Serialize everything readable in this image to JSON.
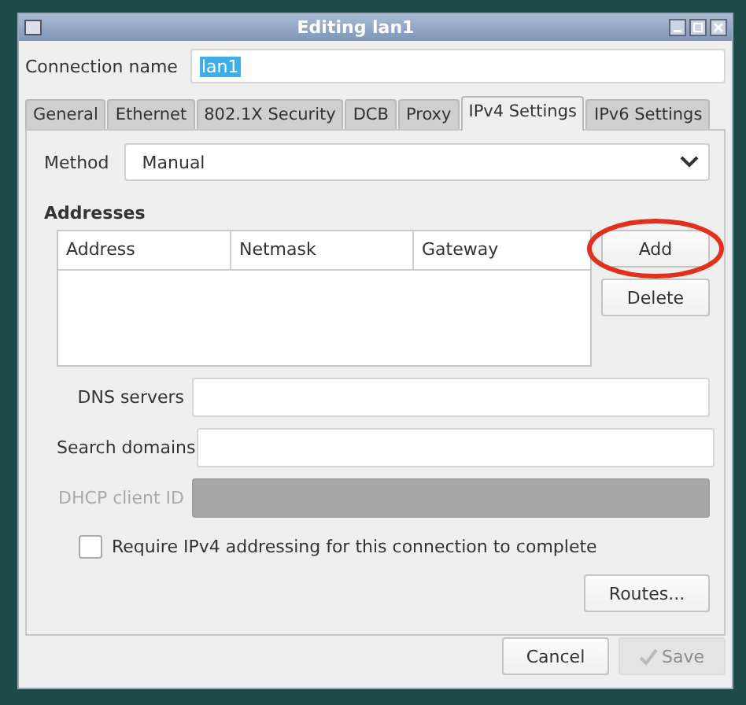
{
  "window": {
    "title": "Editing lan1"
  },
  "connection_name": {
    "label": "Connection name",
    "value": "lan1",
    "selected": true
  },
  "tabs": [
    {
      "label": "General",
      "selected": false
    },
    {
      "label": "Ethernet",
      "selected": false
    },
    {
      "label": "802.1X Security",
      "selected": false
    },
    {
      "label": "DCB",
      "selected": false
    },
    {
      "label": "Proxy",
      "selected": false
    },
    {
      "label": "IPv4 Settings",
      "selected": true
    },
    {
      "label": "IPv6 Settings",
      "selected": false
    }
  ],
  "method": {
    "label": "Method",
    "value": "Manual"
  },
  "addresses": {
    "heading": "Addresses",
    "columns": [
      "Address",
      "Netmask",
      "Gateway"
    ],
    "add_button": {
      "label": "Add",
      "highlighted": true
    },
    "delete_button": "Delete"
  },
  "fields": [
    {
      "label": "DNS servers",
      "disabled": false
    },
    {
      "label": "Search domains",
      "disabled": false
    },
    {
      "label": "DHCP client ID",
      "disabled": true
    }
  ],
  "require_checkbox": {
    "label": "Require IPv4 addressing for this connection to complete",
    "checked": false
  },
  "routes_button": "Routes...",
  "buttons": [
    {
      "label": "Cancel",
      "disabled": false,
      "kind": "plain"
    },
    {
      "label": "Save",
      "disabled": true,
      "kind": "save"
    }
  ]
}
